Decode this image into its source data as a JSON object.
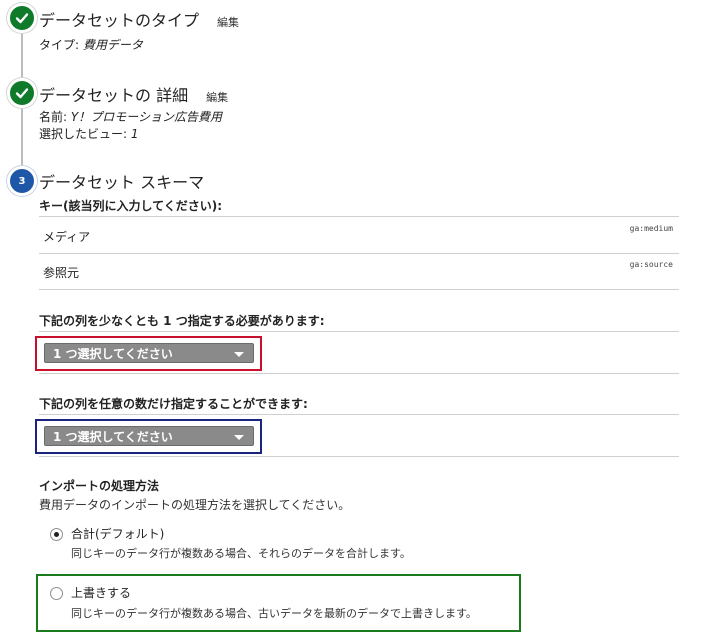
{
  "steps": [
    {
      "number": "",
      "title": "データセットのタイプ",
      "edit_label": "編集",
      "meta_label": "タイプ: ",
      "meta_value": "費用データ"
    },
    {
      "number": "",
      "title": "データセットの 詳細",
      "edit_label": "編集",
      "meta_name_label": "名前: ",
      "meta_name_value": "Y！プロモーション広告費用",
      "meta_view_label": "選択したビュー: ",
      "meta_view_value": "1"
    },
    {
      "number": "3",
      "title": "データセット スキーマ"
    }
  ],
  "schema": {
    "key_label": "キー(該当列に入力してください):",
    "keys": [
      {
        "name": "メディア",
        "code": "ga:medium"
      },
      {
        "name": "参照元",
        "code": "ga:source"
      }
    ],
    "required_label": "下記の列を少なくとも 1 つ指定する必要があります:",
    "required_select": "1 つ選択してください",
    "optional_label": "下記の列を任意の数だけ指定することができます:",
    "optional_select": "1 つ選択してください"
  },
  "import": {
    "title": "インポートの処理方法",
    "description": "費用データのインポートの処理方法を選択してください。",
    "options": [
      {
        "label": "合計(デフォルト)",
        "desc": "同じキーのデータ行が複数ある場合、それらのデータを合計します。",
        "checked": true
      },
      {
        "label": "上書きする",
        "desc": "同じキーのデータ行が複数ある場合、古いデータを最新のデータで上書きします。",
        "checked": false
      }
    ]
  },
  "colors": {
    "done_step": "#0f7a2a",
    "current_step": "#1f57a8",
    "highlight_red": "#c8102e",
    "highlight_blue": "#1a237e",
    "highlight_green": "#1b7a1b"
  }
}
